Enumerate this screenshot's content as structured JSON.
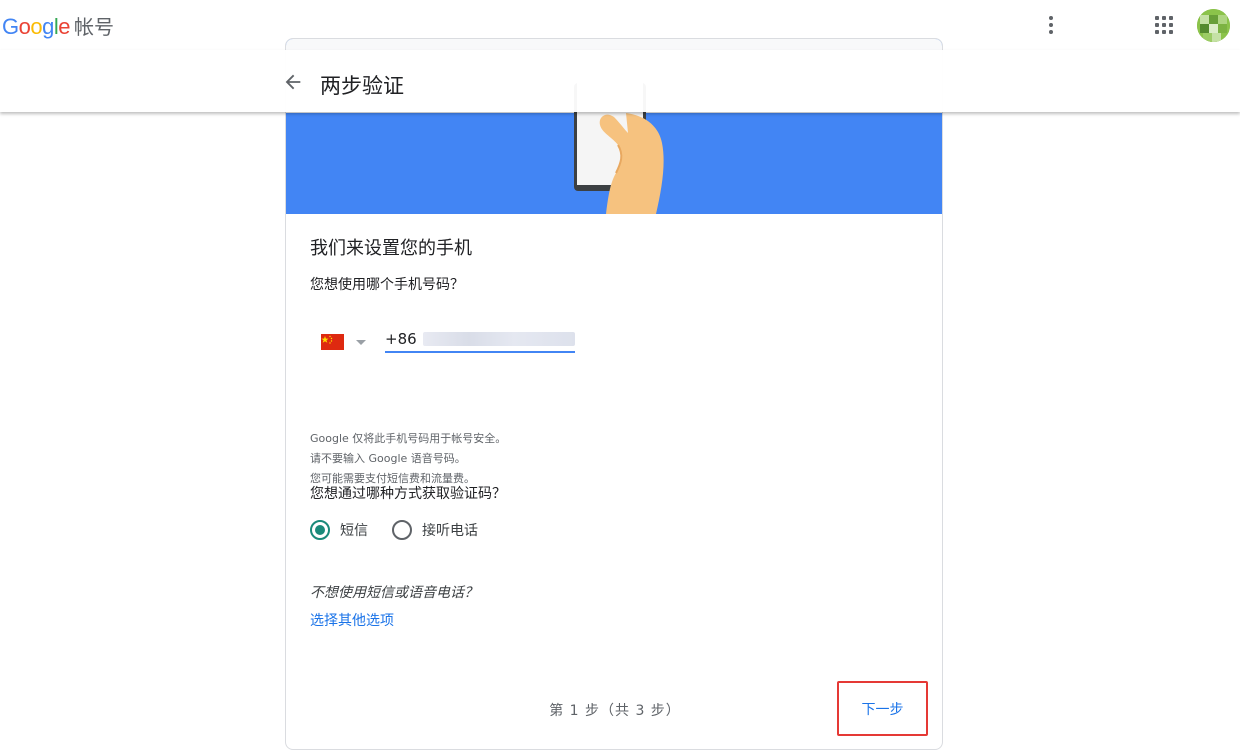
{
  "app": {
    "logo_text": "Google",
    "product_name": "帐号"
  },
  "header": {
    "title": "两步验证"
  },
  "card": {
    "section_title": "我们来设置您的手机",
    "phone_question": "您想使用哪个手机号码？",
    "country_code": "+86",
    "info_lines": [
      "Google 仅将此手机号码用于帐号安全。",
      "请不要输入 Google 语音号码。",
      "您可能需要支付短信费和流量费。"
    ],
    "method_question": "您想通过哪种方式获取验证码？",
    "methods": [
      {
        "label": "短信",
        "checked": true
      },
      {
        "label": "接听电话",
        "checked": false
      }
    ],
    "alt_question": "不想使用短信或语音电话？",
    "alt_link": "选择其他选项",
    "step_indicator": "第 1 步（共 3 步）",
    "next_label": "下一步"
  },
  "colors": {
    "accent": "#1a73e8",
    "hero_blue": "#4285f4",
    "radio_checked": "#1a8a7a",
    "highlight_border": "#e53935"
  },
  "icons": {
    "back": "arrow-left-icon",
    "more": "more-vert-icon",
    "apps": "apps-grid-icon",
    "flag": "china-flag-icon",
    "dropdown": "caret-down-icon"
  }
}
